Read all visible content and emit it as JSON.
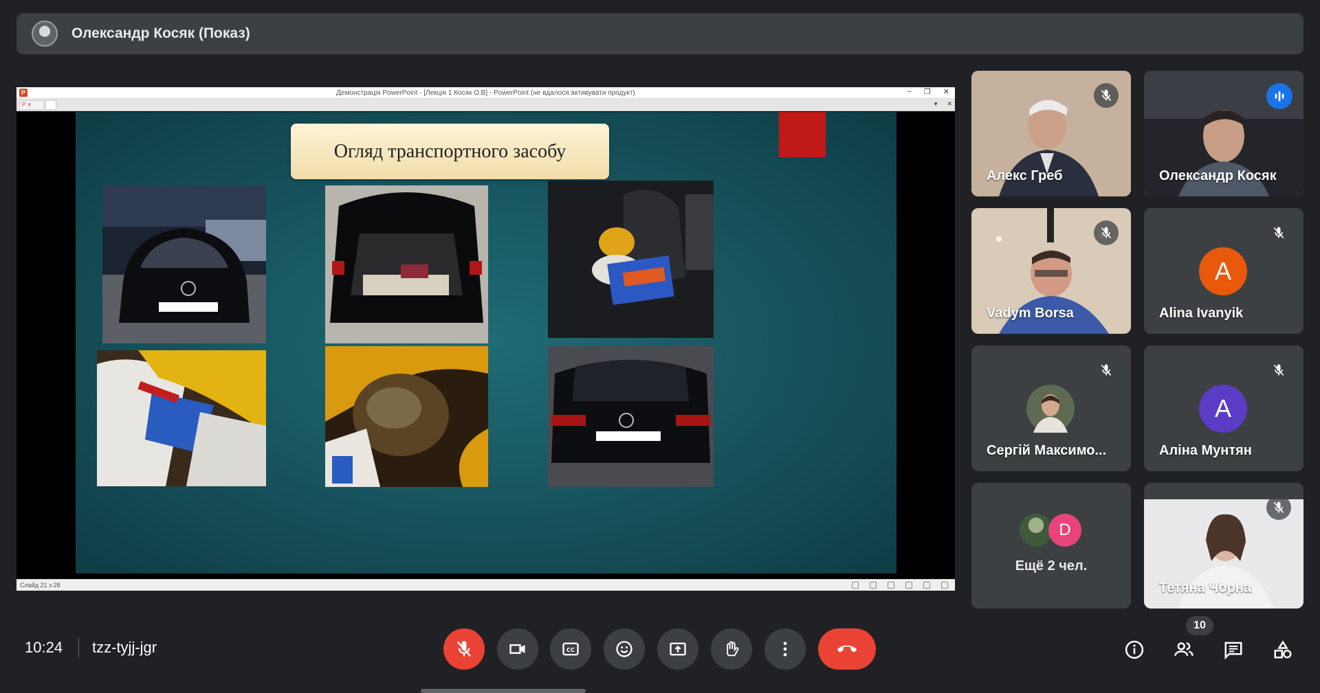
{
  "presenter_banner": {
    "title": "Олександр Косяк (Показ)"
  },
  "powerpoint": {
    "window_title": "Демонстрація PowerPoint - [Лекція 1 Косяк О.В] - PowerPoint (не вдалося активувати продукт)",
    "status_text": "Слайд 21 з 28",
    "slide_title": "Огляд транспортного засобу"
  },
  "participants": [
    {
      "name": "Алекс Греб",
      "muted": true,
      "video": true
    },
    {
      "name": "Олександр Косяк",
      "muted": false,
      "speaking": true,
      "video": true
    },
    {
      "name": "Vadym Borsa",
      "muted": true,
      "video": true
    },
    {
      "name": "Alina Ivanyik",
      "muted": true,
      "avatar_letter": "A",
      "avatar_color": "#e8590c"
    },
    {
      "name": "Сергій Максимо...",
      "muted": true,
      "avatar": "photo"
    },
    {
      "name": "Аліна Мунтян",
      "muted": true,
      "avatar_letter": "A",
      "avatar_color": "#5b3cc4"
    },
    {
      "name": "Ещё 2 чел.",
      "avatar_letter": "D",
      "avatar_color": "#e8437a"
    },
    {
      "name": "Тетяна Чорна",
      "muted": true,
      "video": true
    }
  ],
  "bottom_bar": {
    "time": "10:24",
    "meeting_code": "tzz-tyjj-jgr",
    "participant_count": "10"
  },
  "controls": [
    "mic-off-icon",
    "camera-icon",
    "captions-icon",
    "emoji-icon",
    "present-icon",
    "raise-hand-icon",
    "more-options-icon",
    "end-call-icon"
  ],
  "side_controls": [
    "info-icon",
    "people-icon",
    "chat-icon",
    "activities-icon"
  ]
}
